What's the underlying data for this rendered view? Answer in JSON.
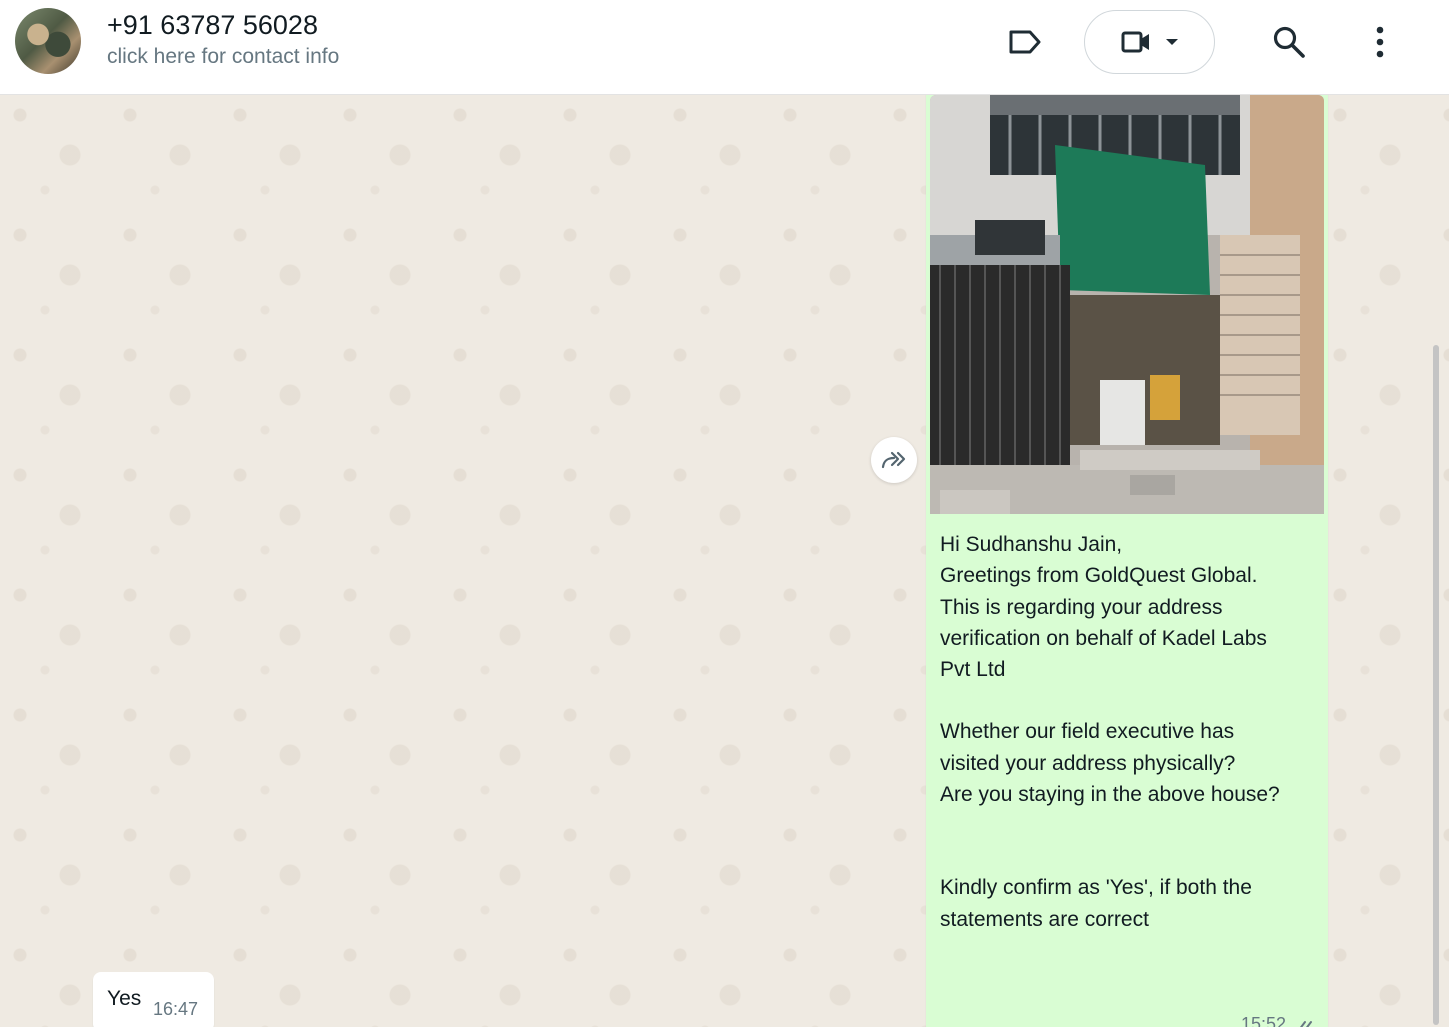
{
  "header": {
    "contact_name": "+91 63787 56028",
    "contact_subtitle": "click here for contact info",
    "icons": {
      "label": "label-icon",
      "video": "video-camera-icon",
      "dropdown": "chevron-down-icon",
      "search": "search-icon",
      "menu": "more-vertical-icon"
    }
  },
  "chat": {
    "outgoing": {
      "lines_1": [
        "Hi Sudhanshu Jain,",
        "Greetings from GoldQuest Global.",
        "This is regarding your address",
        "verification on behalf of Kadel Labs",
        "Pvt Ltd"
      ],
      "lines_2": [
        "Whether our field executive has",
        "visited your address physically?",
        "Are you staying in the above house?"
      ],
      "lines_3": [
        "Kindly confirm as 'Yes', if both the",
        "statements are correct"
      ],
      "time": "15:52",
      "status_icon": "double-check-icon"
    },
    "incoming": {
      "text": "Yes",
      "time": "16:47"
    },
    "forward_icon": "forward-icon"
  },
  "colors": {
    "outgoing_bubble": "#d9fdd3",
    "incoming_bubble": "#ffffff",
    "chat_background": "#efeae2",
    "header_background": "#ffffff"
  }
}
